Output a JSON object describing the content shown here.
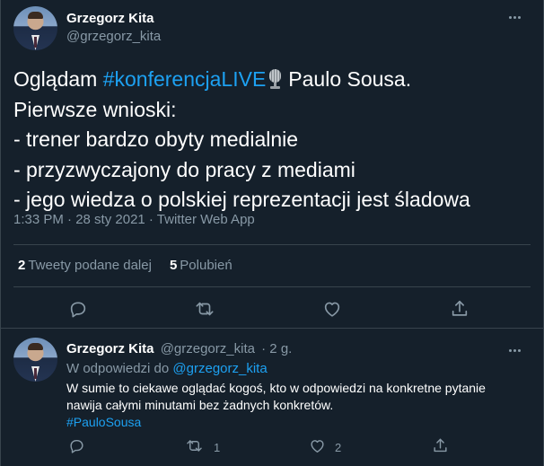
{
  "main": {
    "author_name": "Grzegorz Kita",
    "author_handle": "@grzegorz_kita",
    "text_line1_a": "Oglądam ",
    "hashtag": "#konferencjaLIVE",
    "text_line1_b": "Paulo Sousa.",
    "text_rest": "Pierwsze wnioski:\n- trener bardzo obyty medialnie\n- przyzwyczajony do pracy z mediami\n- jego wiedza o polskiej reprezentacji jest śladowa",
    "meta": "1:33 PM · 28 sty 2021 · Twitter Web App",
    "retweets_count": "2",
    "retweets_label": "Tweety podane dalej",
    "likes_count": "5",
    "likes_label": "Polubień",
    "emoji": "microphone"
  },
  "reply": {
    "author_name": "Grzegorz Kita",
    "author_handle": "@grzegorz_kita",
    "time": "· 2 g.",
    "in_reply_prefix": "W odpowiedzi do",
    "in_reply_handle": "@grzegorz_kita",
    "text_line1": "W sumie to ciekawe oglądać kogoś, kto w odpowiedzi na konkretne pytanie",
    "text_line2": "nawija całymi minutami bez żadnych konkretów.",
    "hashtag": "#PauloSousa",
    "retweet_count": "1",
    "like_count": "2"
  },
  "colors": {
    "background": "#15202b",
    "accent": "#1da1f2",
    "secondary_text": "#8899a6",
    "border": "#38444d"
  },
  "icons": [
    "more-icon",
    "reply-icon",
    "retweet-icon",
    "like-icon",
    "share-icon"
  ]
}
